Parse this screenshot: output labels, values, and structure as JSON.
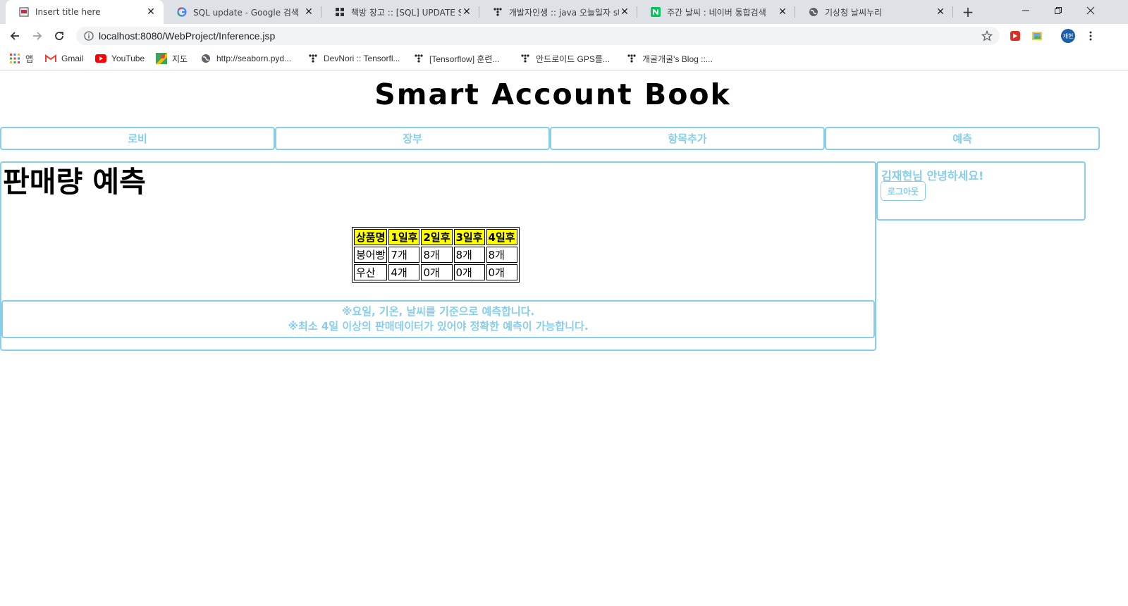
{
  "browser": {
    "tabs": [
      {
        "title": "Insert title here",
        "favicon": "page-icon"
      },
      {
        "title": "SQL update - Google 검색",
        "favicon": "google-icon"
      },
      {
        "title": "책방 창고 :: [SQL] UPDATE SET",
        "favicon": "blog-icon"
      },
      {
        "title": "개발자인생 :: java 오늘일자 st",
        "favicon": "tistory-icon"
      },
      {
        "title": "주간 날씨 : 네이버 통합검색",
        "favicon": "naver-icon"
      },
      {
        "title": "기상청 날씨누리",
        "favicon": "globe-icon"
      }
    ],
    "address_url": "localhost:8080/WebProject/Inference.jsp",
    "avatar_label": "재현",
    "bookmarks": [
      {
        "label": "앱",
        "icon": "apps-grid-icon"
      },
      {
        "label": "Gmail",
        "icon": "gmail-icon"
      },
      {
        "label": "YouTube",
        "icon": "youtube-icon"
      },
      {
        "label": "지도",
        "icon": "maps-icon"
      },
      {
        "label": "http://seaborn.pyd...",
        "icon": "globe-icon"
      },
      {
        "label": "DevNori :: Tensorfl...",
        "icon": "tistory-icon"
      },
      {
        "label": "[Tensorflow] 훈련...",
        "icon": "tistory-icon"
      },
      {
        "label": "안드로이드 GPS를...",
        "icon": "tistory-icon"
      },
      {
        "label": "개굴개굴's Blog ::...",
        "icon": "tistory-icon"
      }
    ]
  },
  "page": {
    "site_title": "Smart Account Book",
    "menu": [
      "로비",
      "장부",
      "항목추가",
      "예측"
    ],
    "heading": "판매량 예측",
    "table": {
      "headers": [
        "상품명",
        "1일후",
        "2일후",
        "3일후",
        "4일후"
      ],
      "rows": [
        [
          "붕어빵",
          "7개",
          "8개",
          "8개",
          "8개"
        ],
        [
          "우산",
          "4개",
          "0개",
          "0개",
          "0개"
        ]
      ]
    },
    "notice": [
      "※요일, 기온, 날씨를 기준으로 예측합니다.",
      "※최소 4일 이상의 판매데이터가 있어야 정확한 예측이 가능합니다."
    ],
    "greeting": "김재현님 안녕하세요!",
    "logout_label": "로그아웃"
  },
  "colors": {
    "accent": "#87ceeb",
    "table_header_bg": "#ffff00",
    "avatar_bg": "#1a5fa8"
  }
}
